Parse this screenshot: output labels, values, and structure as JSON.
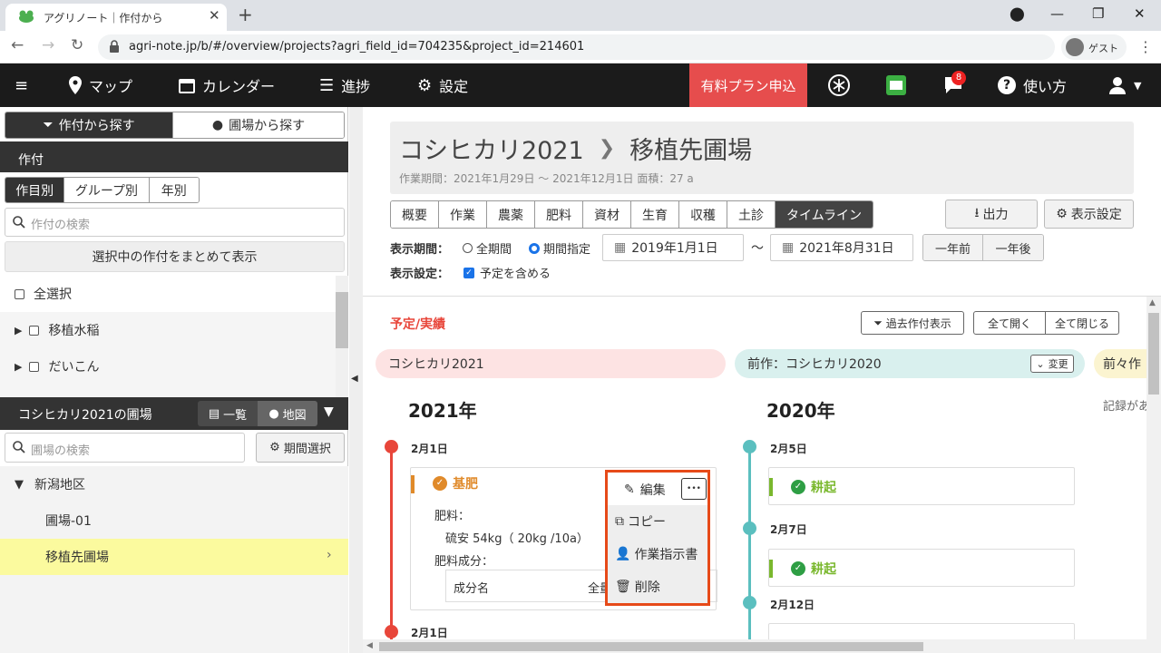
{
  "browser": {
    "tab_title": "アグリノート｜作付から",
    "url": "agri-note.jp/b/#/overview/projects?agri_field_id=704235&project_id=214601",
    "guest_label": "ゲスト"
  },
  "header": {
    "nav": [
      {
        "label": "マップ",
        "icon": "map-pin-icon"
      },
      {
        "label": "カレンダー",
        "icon": "calendar-icon"
      },
      {
        "label": "進捗",
        "icon": "progress-list-icon"
      },
      {
        "label": "設定",
        "icon": "gear-icon"
      }
    ],
    "paid_plan": "有料プラン申込",
    "notification_count": "8",
    "help": "使い方",
    "accent": "#e64d4d"
  },
  "sidebar": {
    "search_tabs": [
      "作付から探す",
      "圃場から探す"
    ],
    "crop_section": "作付",
    "filter_tabs": [
      "作目別",
      "グループ別",
      "年別"
    ],
    "crop_search_placeholder": "作付の検索",
    "show_selected": "選択中の作付をまとめて表示",
    "select_all": "全選択",
    "crops": [
      "移植水稲",
      "だいこん"
    ],
    "field_section": "コシヒカリ2021の圃場",
    "view_list": "一覧",
    "view_map": "地図",
    "field_search_placeholder": "圃場の検索",
    "period_select": "期間選択",
    "region": "新潟地区",
    "fields": [
      "圃場-01",
      "移植先圃場"
    ],
    "highlight": "#fbfa9e"
  },
  "main": {
    "crop_name": "コシヒカリ2021",
    "field_name": "移植先圃場",
    "subtitle": "作業期間：2021年1月29日 〜 2021年12月1日 面積：27 a",
    "tabs": [
      "概要",
      "作業",
      "農薬",
      "肥料",
      "資材",
      "生育",
      "収穫",
      "土診",
      "タイムライン"
    ],
    "active_tab": "タイムライン",
    "export": "出力",
    "display_settings": "表示設定",
    "period_label": "表示期間：",
    "period_all": "全期間",
    "period_custom": "期間指定",
    "date_from": "2019年1月1日",
    "date_to": "2021年8月31日",
    "tilde": "〜",
    "year_prev": "一年前",
    "year_next": "一年後",
    "settings_label": "表示設定：",
    "include_planned": "予定を含める"
  },
  "timeline": {
    "section_title": "予定/実績",
    "past_crops": "過去作付表示",
    "expand_all": "全て開く",
    "collapse_all": "全て閉じる",
    "current_crop": "コシヒカリ2021",
    "prev_crop": "前作：コシヒカリ2020",
    "change": "変更",
    "prev_prev_crop": "前々作",
    "no_record": "記録があ",
    "col1_year": "2021年",
    "col2_year": "2020年",
    "col1": {
      "date1": "2月1日",
      "date2": "2月1日",
      "card_title": "基肥",
      "fert_label": "肥料：",
      "fert_value": "硫安 54kg（ 20kg /10a）",
      "comp_label": "肥料成分：",
      "comp_name": "成分名",
      "comp_total": "全量"
    },
    "col2": {
      "date1": "2月5日",
      "date2": "2月7日",
      "date3": "2月12日",
      "card1": "耕起",
      "card2": "耕起"
    },
    "menu": {
      "edit": "編集",
      "more": "•••",
      "copy": "コピー",
      "instruction": "作業指示書",
      "delete": "削除"
    },
    "colors": {
      "red": "#e8463a",
      "teal": "#5bbfbf",
      "orange": "#e08a2a",
      "green": "#7ab82e"
    }
  }
}
